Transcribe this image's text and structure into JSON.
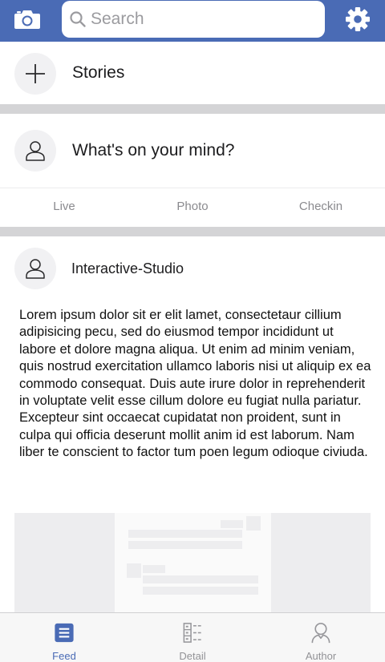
{
  "header": {
    "search_placeholder": "Search",
    "bar_color": "#4a6bb5",
    "left_icon": "camera-icon",
    "right_icon": "gear-icon"
  },
  "stories": {
    "label": "Stories",
    "icon": "plus-icon"
  },
  "composer": {
    "prompt": "What's on your mind?",
    "icon": "user-icon"
  },
  "composer_actions": [
    "Live",
    "Photo",
    "Checkin"
  ],
  "post": {
    "author": "Interactive-Studio",
    "body": "Lorem ipsum dolor sit er elit lamet, consectetaur cillium adipisicing pecu, sed do eiusmod tempor incididunt ut labore et dolore magna aliqua. Ut enim ad minim veniam, quis nostrud exercitation ullamco laboris nisi ut aliquip ex ea commodo consequat. Duis aute irure dolor in reprehenderit in voluptate velit esse cillum dolore eu fugiat nulla pariatur. Excepteur sint occaecat cupidatat non proident, sunt in culpa qui officia deserunt mollit anim id est laborum. Nam liber te conscient to factor tum poen legum odioque civiuda."
  },
  "tabbar": {
    "tabs": [
      {
        "label": "Feed",
        "icon": "feed-icon",
        "active": true
      },
      {
        "label": "Detail",
        "icon": "detail-icon",
        "active": false
      },
      {
        "label": "Author",
        "icon": "author-icon",
        "active": false
      }
    ],
    "active_color": "#4a6bb5",
    "inactive_color": "#929296"
  }
}
